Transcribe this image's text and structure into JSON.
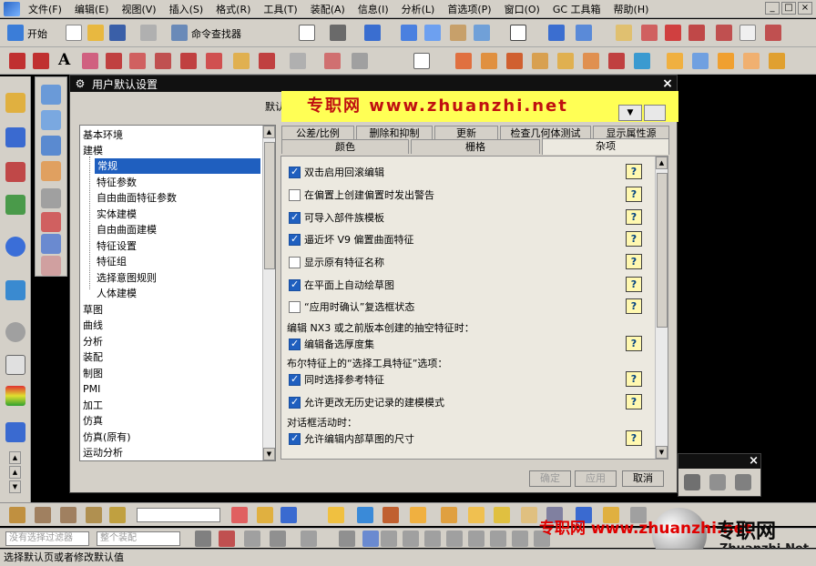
{
  "menubar": {
    "items": [
      "文件(F)",
      "编辑(E)",
      "视图(V)",
      "插入(S)",
      "格式(R)",
      "工具(T)",
      "装配(A)",
      "信息(I)",
      "分析(L)",
      "首选项(P)",
      "窗口(O)",
      "GC 工具箱",
      "帮助(H)"
    ],
    "window_controls": [
      "_",
      "□",
      "×"
    ]
  },
  "toolbar": {
    "start_label": "开始",
    "command_finder_label": "命令查找器"
  },
  "dialog": {
    "title": "用户默认设置",
    "close": "×",
    "default_label": "默认",
    "banner": "专职网 www.zhuanzhi.net",
    "tree": {
      "items": [
        {
          "label": "基本环境",
          "level": 0
        },
        {
          "label": "建模",
          "level": 0
        },
        {
          "label": "常规",
          "level": 1,
          "selected": true
        },
        {
          "label": "特征参数",
          "level": 1
        },
        {
          "label": "自由曲面特征参数",
          "level": 1
        },
        {
          "label": "实体建模",
          "level": 1
        },
        {
          "label": "自由曲面建模",
          "level": 1
        },
        {
          "label": "特征设置",
          "level": 1
        },
        {
          "label": "特征组",
          "level": 1
        },
        {
          "label": "选择意图规则",
          "level": 1
        },
        {
          "label": "人体建模",
          "level": 1
        },
        {
          "label": "草图",
          "level": 0
        },
        {
          "label": "曲线",
          "level": 0
        },
        {
          "label": "分析",
          "level": 0
        },
        {
          "label": "装配",
          "level": 0
        },
        {
          "label": "制图",
          "level": 0
        },
        {
          "label": "PMI",
          "level": 0
        },
        {
          "label": "加工",
          "level": 0
        },
        {
          "label": "仿真",
          "level": 0
        },
        {
          "label": "仿真(原有)",
          "level": 0
        },
        {
          "label": "运动分析",
          "level": 0
        }
      ]
    },
    "tabs_row1": [
      "公差/比例",
      "删除和抑制",
      "更新",
      "检查几何体测试",
      "显示属性源"
    ],
    "tabs_row2": [
      "颜色",
      "栅格",
      "杂项"
    ],
    "active_tab": "杂项",
    "options": [
      {
        "label": "双击启用回滚编辑",
        "checked": true
      },
      {
        "label": "在偏置上创建偏置时发出警告",
        "checked": false
      },
      {
        "label": "可导入部件族模板",
        "checked": true
      },
      {
        "label": "逼近坏 V9 偏置曲面特征",
        "checked": true
      },
      {
        "label": "显示原有特征名称",
        "checked": false
      },
      {
        "label": "在平面上自动绘草图",
        "checked": true
      },
      {
        "label": "“应用时确认”复选框状态",
        "checked": false
      }
    ],
    "section1": {
      "heading": "编辑 NX3 或之前版本创建的抽空特征时：",
      "options": [
        {
          "label": "编辑备选厚度集",
          "checked": true
        }
      ]
    },
    "section2": {
      "heading": "布尔特征上的“选择工具特征”选项：",
      "options": [
        {
          "label": "同时选择参考特征",
          "checked": true
        },
        {
          "label": "允许更改无历史记录的建模模式",
          "checked": true
        }
      ]
    },
    "section3": {
      "heading": "对话框活动时：",
      "options": [
        {
          "label": "允许编辑内部草图的尺寸",
          "checked": true
        }
      ]
    },
    "help_symbol": "?",
    "buttons": {
      "ok": "确定",
      "apply": "应用",
      "cancel": "取消"
    }
  },
  "bottombar": {
    "filter_combo": "没有选择过滤器",
    "assembly_combo": "整个装配"
  },
  "status": "选择默认页或者修改默认值",
  "watermark": {
    "text": "专职网 www.zhuanzhi.net",
    "brand": "专职网",
    "url": "Zhuanzhi.Net"
  }
}
